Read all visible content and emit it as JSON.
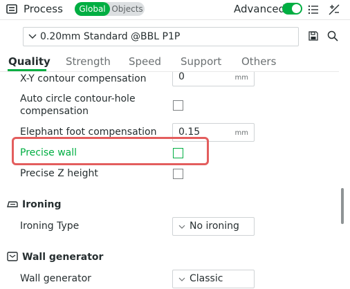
{
  "header": {
    "title": "Process",
    "mode_global": "Global",
    "mode_objects": "Objects",
    "advanced_label": "Advanced",
    "advanced_on": true
  },
  "preset": {
    "name": "0.20mm Standard @BBL P1P"
  },
  "tabs": [
    {
      "label": "Quality",
      "active": true
    },
    {
      "label": "Strength",
      "active": false
    },
    {
      "label": "Speed",
      "active": false
    },
    {
      "label": "Support",
      "active": false
    },
    {
      "label": "Others",
      "active": false
    }
  ],
  "settings": {
    "xy_comp": {
      "label": "X-Y contour compensation",
      "value": "0",
      "unit": "mm"
    },
    "auto_circle": {
      "label_line1": "Auto circle contour-hole",
      "label_line2": "compensation",
      "checked": false
    },
    "elephant_foot": {
      "label": "Elephant foot compensation",
      "value": "0.15",
      "unit": "mm"
    },
    "precise_wall": {
      "label": "Precise wall",
      "checked": false,
      "highlighted": true
    },
    "precise_z": {
      "label": "Precise Z height",
      "checked": false
    }
  },
  "ironing": {
    "section_title": "Ironing",
    "type_label": "Ironing Type",
    "type_value": "No ironing"
  },
  "wall_generator": {
    "section_title": "Wall generator",
    "label": "Wall generator",
    "value": "Classic"
  },
  "colors": {
    "accent": "#00ae42",
    "highlight_box": "#e35d5d",
    "text": "#262e30"
  }
}
